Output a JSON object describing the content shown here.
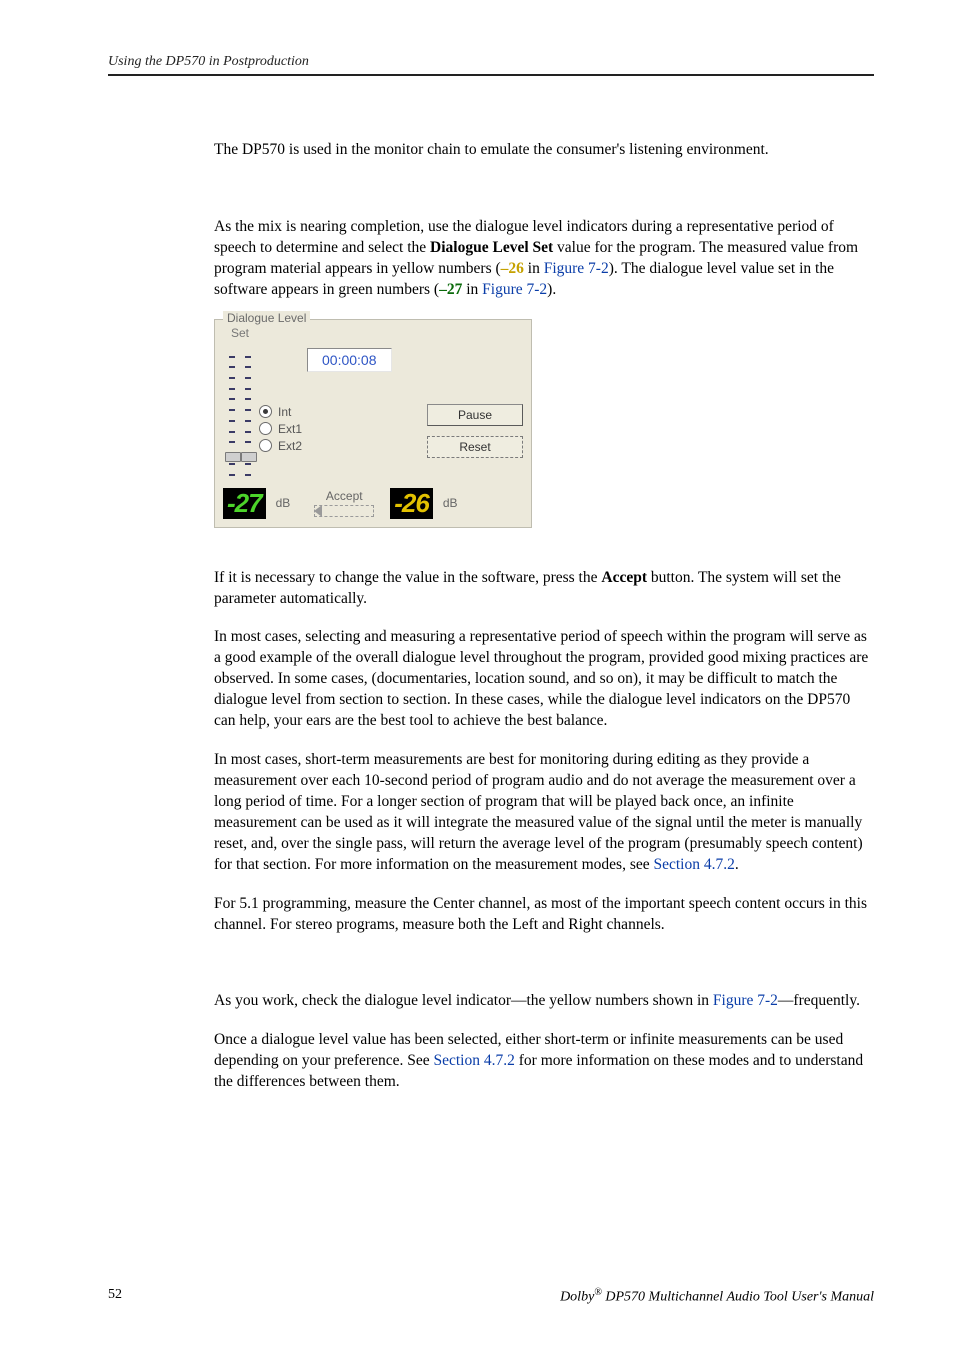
{
  "header": {
    "running_head": "Using the DP570 in Postproduction"
  },
  "p1": "The DP570 is used in the monitor chain to emulate the consumer's listening environment.",
  "p2a": "As the mix is nearing completion, use the dialogue level indicators during a representative period of speech to determine and select the ",
  "p2_bold": "Dialogue Level Set",
  "p2b": " value for the program. The measured value from program material appears in yellow numbers (",
  "p2_yellow": "–26",
  "p2c": " in ",
  "p2_link1": "Figure 7-2",
  "p2d": "). The dialogue level value set in the software appears in green numbers (",
  "p2_green": "–27",
  "p2e": " in ",
  "p2_link2": "Figure 7-2",
  "p2f": ").",
  "figure": {
    "group_title": "Dialogue Level",
    "set_label": "Set",
    "timer": "00:00:08",
    "radios": {
      "int": "Int",
      "ext1": "Ext1",
      "ext2": "Ext2"
    },
    "buttons": {
      "pause": "Pause",
      "reset": "Reset"
    },
    "accept": "Accept",
    "left_value": "-27",
    "right_value": "-26",
    "db": "dB"
  },
  "p3a": "If it is necessary to change the value in the software, press the ",
  "p3_bold": "Accept",
  "p3b": " button. The system will set the parameter automatically.",
  "p4": "In most cases, selecting and measuring a representative period of speech within the program will serve as a good example of the overall dialogue level throughout the program, provided good mixing practices are observed. In some cases, (documentaries, location sound, and so on), it may be difficult to match the dialogue level from section to section. In these cases, while the dialogue level indicators on the DP570 can help, your ears are the best tool to achieve the best balance.",
  "p5a": "In most cases, short-term measurements are best for monitoring during editing as they provide a measurement over each 10-second period of program audio and do not average the measurement over a long period of time. For a longer section of program that will be played back once, an infinite measurement can be used as it will integrate the measured value of the signal until the meter is manually reset, and, over the single pass, will return the average level of the program (presumably speech content) for that section. For more information on the measurement modes, see ",
  "p5_link": "Section 4.7.2",
  "p5b": ".",
  "p6": "For 5.1 programming, measure the Center channel, as most of the important speech content occurs in this channel. For stereo programs, measure both the Left and Right channels.",
  "p7a": "As you work, check the dialogue level indicator—the yellow numbers shown in ",
  "p7_link": "Figure 7-2",
  "p7b": "—frequently.",
  "p8a": "Once a dialogue level value has been selected, either short-term or infinite measurements can be used depending on your preference. See ",
  "p8_link": "Section 4.7.2",
  "p8b": " for more information on these modes and to understand the differences between them.",
  "footer": {
    "page": "52",
    "book_prefix": "Dolby",
    "book_reg": "®",
    "book_rest": " DP570 Multichannel Audio Tool User's Manual"
  }
}
